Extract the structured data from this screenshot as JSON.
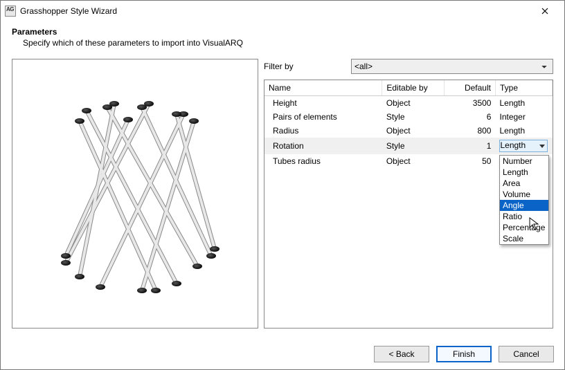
{
  "window": {
    "title": "Grasshopper Style Wizard"
  },
  "section": {
    "title": "Parameters",
    "description": "Specify which of these parameters to import into VisualARQ"
  },
  "filter": {
    "label": "Filter by",
    "value": "<all>"
  },
  "grid": {
    "headers": {
      "name": "Name",
      "editable": "Editable by",
      "default": "Default",
      "type": "Type"
    },
    "rows": [
      {
        "name": "Height",
        "editable": "Object",
        "default": "3500",
        "type": "Length",
        "selected": false
      },
      {
        "name": "Pairs of elements",
        "editable": "Style",
        "default": "6",
        "type": "Integer",
        "selected": false
      },
      {
        "name": "Radius",
        "editable": "Object",
        "default": "800",
        "type": "Length",
        "selected": false
      },
      {
        "name": "Rotation",
        "editable": "Style",
        "default": "1",
        "type": "Length",
        "selected": true
      },
      {
        "name": "Tubes radius",
        "editable": "Object",
        "default": "50",
        "type": "",
        "selected": false
      }
    ]
  },
  "typeDropdown": {
    "selected": "Length",
    "highlighted": "Angle",
    "options": [
      "Number",
      "Length",
      "Area",
      "Volume",
      "Angle",
      "Ratio",
      "Percentage",
      "Scale"
    ]
  },
  "footer": {
    "back": "< Back",
    "finish": "Finish",
    "cancel": "Cancel"
  }
}
